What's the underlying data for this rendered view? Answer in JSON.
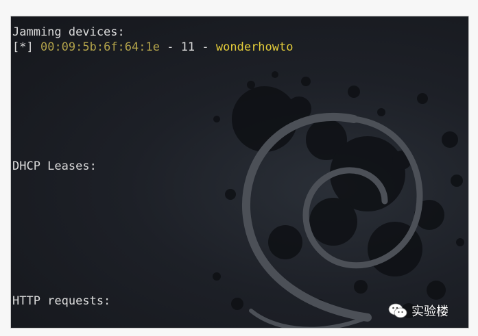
{
  "terminal": {
    "line1": "Jamming devices:",
    "prompt_prefix": "[*]",
    "mac": "00:09:5b:6f:64:1e",
    "sep1": " - ",
    "channel": "11",
    "sep2": " - ",
    "ssid": "wonderhowto",
    "dhcp_label": "DHCP Leases:",
    "http_label": "HTTP requests:"
  },
  "wallpaper": {
    "logo_icon": "debian-swirl-icon"
  },
  "watermark": {
    "icon": "wechat-icon",
    "text": "实验楼"
  },
  "colors": {
    "text": "#dcdcdc",
    "mac": "#b3a34a",
    "ssid": "#e3cc3a",
    "background": "#1d2027"
  }
}
